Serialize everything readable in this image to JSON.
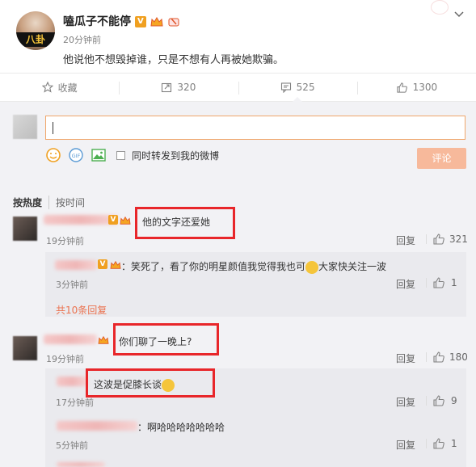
{
  "post": {
    "author": "嗑瓜子不能停",
    "avatar_text": "八卦",
    "time": "20分钟前",
    "text": "他说他不想毁掉谁，只是不想有人再被她欺骗。"
  },
  "actions": {
    "favorite": "收藏",
    "repost": "320",
    "comment": "525",
    "like": "1300"
  },
  "composer": {
    "repost_label": "同时转发到我的微博",
    "submit": "评论"
  },
  "sort": {
    "hot": "按热度",
    "time": "按时间"
  },
  "labels": {
    "reply": "回复"
  },
  "comments": [
    {
      "text": "他的文字还爱她",
      "time": "19分钟前",
      "likes": "321"
    },
    {
      "text": "你们聊了一晚上?",
      "time": "19分钟前",
      "likes": "180"
    }
  ],
  "replies": [
    {
      "text_a": "：笑死了，看了你的明星颜值我觉得我也可",
      "text_b": "大家快关注一波",
      "time": "3分钟前",
      "likes": "1"
    },
    {
      "text": "这波是促膝长谈",
      "time": "17分钟前",
      "likes": "9"
    },
    {
      "text": "：啊哈哈哈哈哈哈哈",
      "time": "5分钟前",
      "likes": "1"
    }
  ],
  "more_replies": "共10条回复",
  "colors": {
    "accent": "#eb7350",
    "highlight": "#e8262a",
    "submit_bg": "#f7b99b",
    "input_border": "#f0a66b"
  },
  "icons": [
    "star-icon",
    "repost-icon",
    "comment-icon",
    "thumb-up-icon",
    "smiley-icon",
    "gif-icon",
    "image-icon",
    "chevron-down-icon"
  ]
}
